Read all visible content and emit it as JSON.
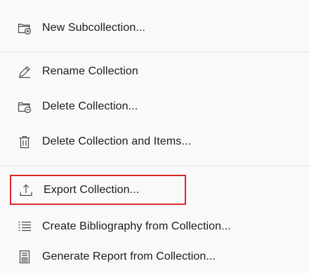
{
  "menu": {
    "items": [
      {
        "label": "New Subcollection...",
        "icon": "folder-plus-icon"
      },
      {
        "label": "Rename Collection",
        "icon": "pencil-icon"
      },
      {
        "label": "Delete Collection...",
        "icon": "folder-minus-icon"
      },
      {
        "label": "Delete Collection and Items...",
        "icon": "trash-icon"
      },
      {
        "label": "Export Collection...",
        "icon": "export-icon"
      },
      {
        "label": "Create Bibliography from Collection...",
        "icon": "list-icon"
      },
      {
        "label": "Generate Report from Collection...",
        "icon": "report-icon"
      }
    ]
  },
  "highlight_color": "#e0262b"
}
